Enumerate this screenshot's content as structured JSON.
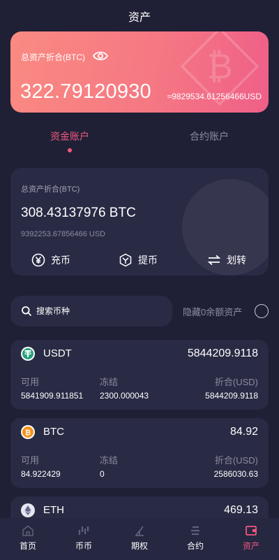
{
  "header": {
    "title": "资产"
  },
  "total": {
    "label": "总资产折合(BTC)",
    "value": "322.79120930",
    "usd": "≈9829534.61256466USD"
  },
  "tabs": [
    {
      "label": "资金账户",
      "active": true
    },
    {
      "label": "合约账户",
      "active": false
    }
  ],
  "account": {
    "label": "总资产折合(BTC)",
    "btc": "308.43137976 BTC",
    "usd": "9392253.67856466 USD",
    "actions": [
      {
        "label": "充币",
        "icon": "yen-circle-icon"
      },
      {
        "label": "提币",
        "icon": "withdraw-shield-icon"
      },
      {
        "label": "划转",
        "icon": "transfer-arrows-icon"
      }
    ]
  },
  "search": {
    "placeholder": "搜索币种"
  },
  "hide_zero": {
    "label": "隐藏0余额资产"
  },
  "assets": [
    {
      "name": "USDT",
      "icon": "tether-icon",
      "total": "5844209.9118",
      "available_label": "可用",
      "available": "5841909.911851",
      "frozen_label": "冻结",
      "frozen": "2300.000043",
      "equiv_label": "折合(USD)",
      "equiv": "5844209.9118"
    },
    {
      "name": "BTC",
      "icon": "bitcoin-icon",
      "total": "84.92",
      "available_label": "可用",
      "available": "84.922429",
      "frozen_label": "冻结",
      "frozen": "0",
      "equiv_label": "折合(USD)",
      "equiv": "2586030.63"
    },
    {
      "name": "ETH",
      "icon": "ethereum-icon",
      "total": "469.13"
    }
  ],
  "nav": [
    {
      "label": "首页",
      "icon": "home-icon",
      "active": false
    },
    {
      "label": "币币",
      "icon": "trade-icon",
      "active": false
    },
    {
      "label": "期权",
      "icon": "options-icon",
      "active": false
    },
    {
      "label": "合约",
      "icon": "contract-icon",
      "active": false
    },
    {
      "label": "资产",
      "icon": "wallet-icon",
      "active": true
    }
  ],
  "colors": {
    "background": "#1f2035",
    "card": "#292a44",
    "accent": "#f2587f",
    "muted": "#8c8da3"
  }
}
